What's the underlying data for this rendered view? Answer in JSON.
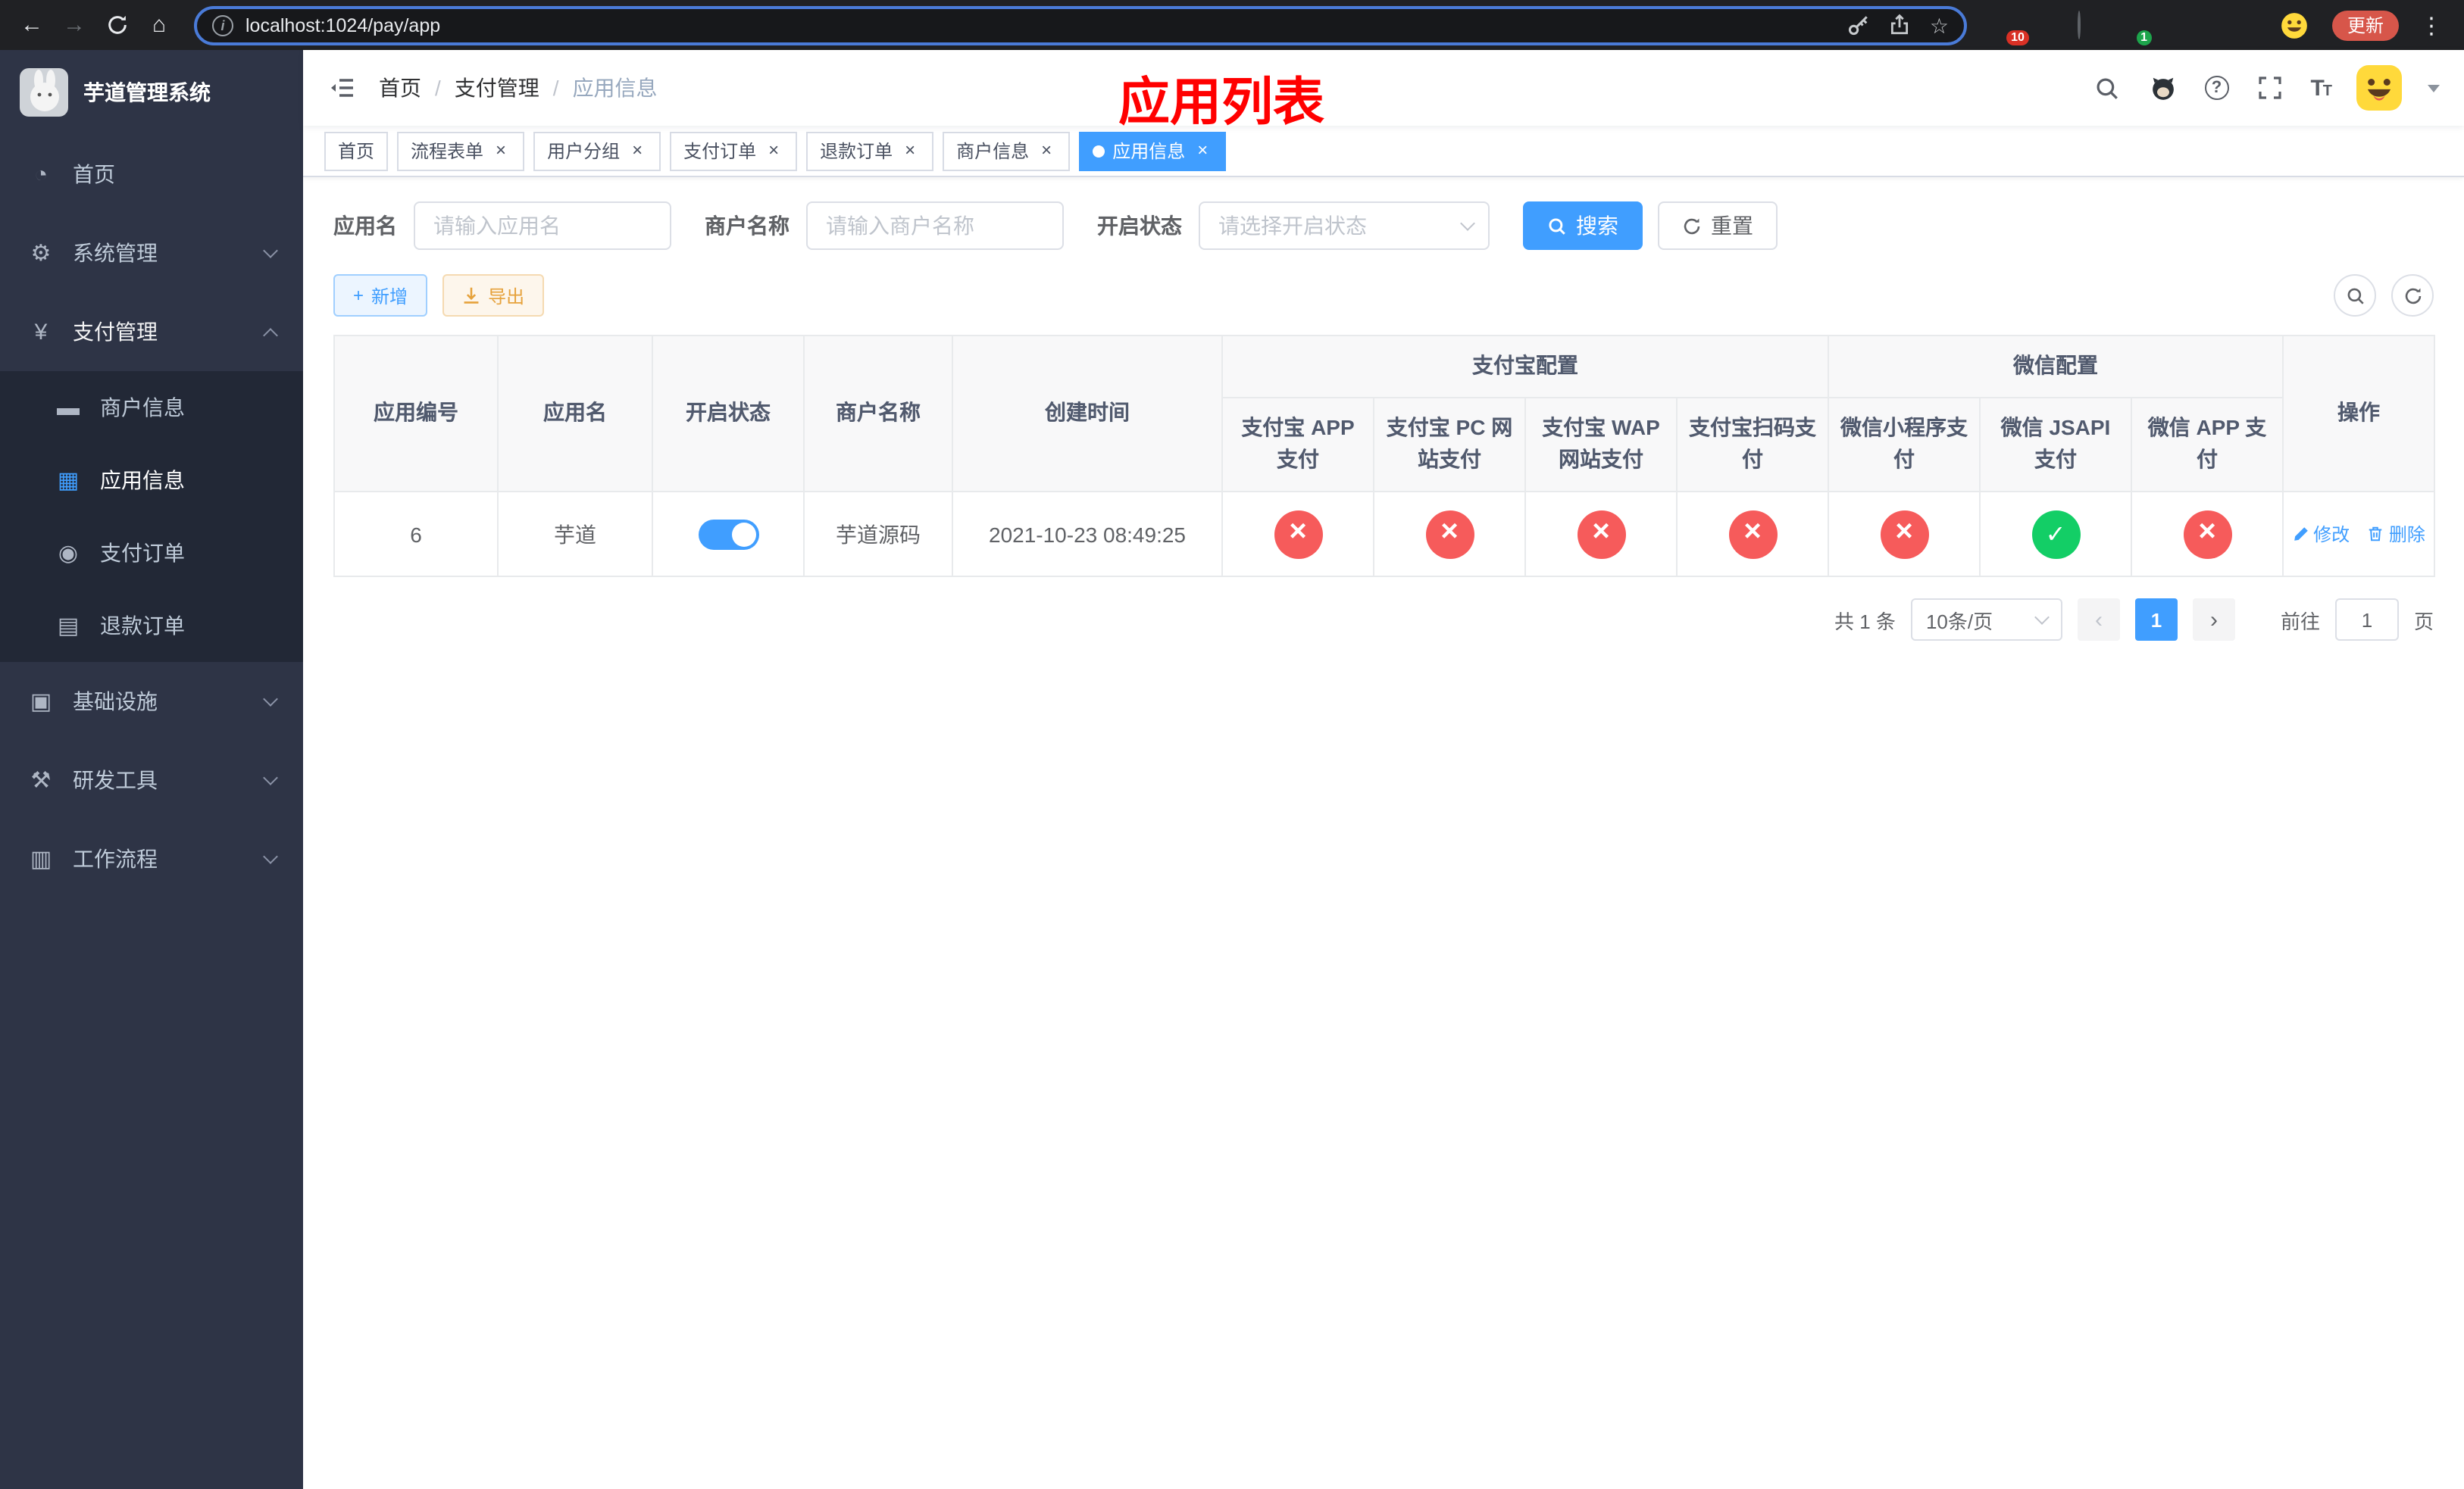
{
  "colors": {
    "accent": "#409eff",
    "danger": "#f65b5b",
    "success": "#13ce66",
    "annotation": "#ff0000",
    "sidebar_bg": "#2e3446",
    "chrome_bg": "#202124"
  },
  "browser": {
    "url": "localhost:1024/pay/app",
    "update_button": "更新",
    "extension_badge_count": "10",
    "profile_badge_count": "1"
  },
  "sidebar": {
    "logo_title": "芋道管理系统",
    "items": [
      {
        "label": "首页"
      },
      {
        "label": "系统管理"
      },
      {
        "label": "支付管理"
      },
      {
        "label": "基础设施"
      },
      {
        "label": "研发工具"
      },
      {
        "label": "工作流程"
      }
    ],
    "payment_children": [
      {
        "label": "商户信息"
      },
      {
        "label": "应用信息"
      },
      {
        "label": "支付订单"
      },
      {
        "label": "退款订单"
      }
    ]
  },
  "header": {
    "breadcrumb": [
      {
        "label": "首页"
      },
      {
        "label": "支付管理"
      },
      {
        "label": "应用信息"
      }
    ],
    "annotation": "应用列表"
  },
  "tabs": [
    {
      "label": "首页"
    },
    {
      "label": "流程表单"
    },
    {
      "label": "用户分组"
    },
    {
      "label": "支付订单"
    },
    {
      "label": "退款订单"
    },
    {
      "label": "商户信息"
    },
    {
      "label": "应用信息"
    }
  ],
  "filters": {
    "app_name": {
      "label": "应用名",
      "placeholder": "请输入应用名",
      "value": ""
    },
    "merchant_name": {
      "label": "商户名称",
      "placeholder": "请输入商户名称",
      "value": ""
    },
    "status": {
      "label": "开启状态",
      "placeholder": "请选择开启状态",
      "value": ""
    },
    "search_button": "搜索",
    "reset_button": "重置"
  },
  "toolbar": {
    "add_button": "新增",
    "export_button": "导出"
  },
  "table": {
    "group_headers": {
      "alipay": "支付宝配置",
      "wechat": "微信配置"
    },
    "columns": [
      "应用编号",
      "应用名",
      "开启状态",
      "商户名称",
      "创建时间",
      "支付宝 APP 支付",
      "支付宝 PC 网站支付",
      "支付宝 WAP 网站支付",
      "支付宝扫码支付",
      "微信小程序支付",
      "微信 JSAPI 支付",
      "微信 APP 支付",
      "操作"
    ],
    "rows": [
      {
        "id": "6",
        "name": "芋道",
        "enabled": true,
        "merchant": "芋道源码",
        "created_at": "2021-10-23 08:49:25",
        "channels": [
          false,
          false,
          false,
          false,
          false,
          true,
          false
        ],
        "edit_label": "修改",
        "delete_label": "删除"
      }
    ]
  },
  "pagination": {
    "total_text": "共 1 条",
    "page_size": "10条/页",
    "current_page": "1",
    "goto_label": "前往",
    "goto_value": "1",
    "goto_unit": "页"
  }
}
